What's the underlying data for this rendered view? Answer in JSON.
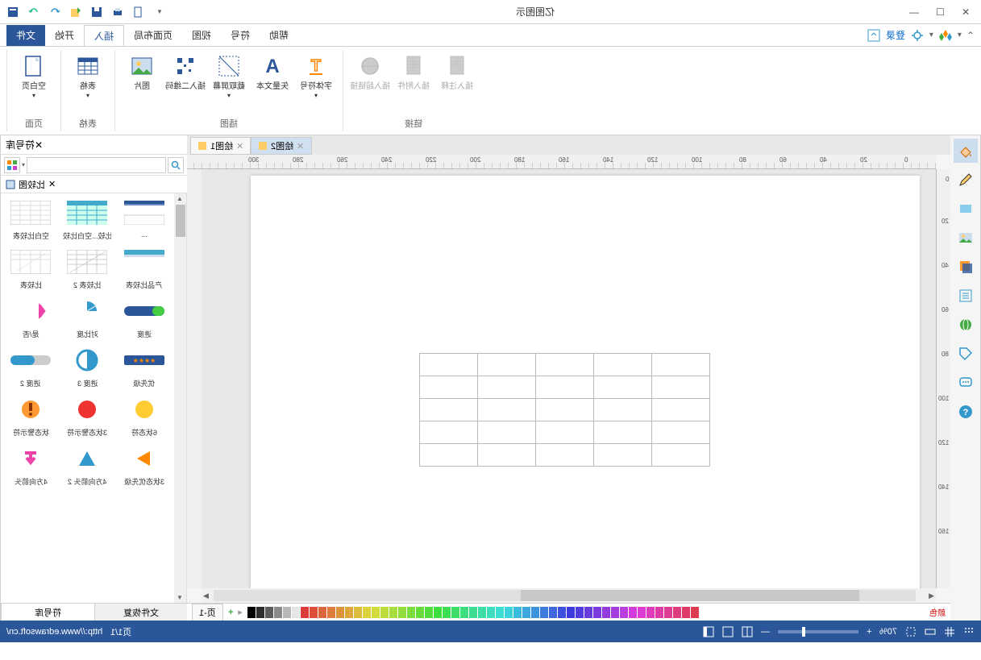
{
  "title": "亿图图示",
  "secondbar": {
    "login": "登录"
  },
  "tabs": [
    "文件",
    "开始",
    "插入",
    "页面布局",
    "视图",
    "符号",
    "帮助"
  ],
  "active_tab_index": 2,
  "file_tab_index": 0,
  "ribbon": {
    "groups": [
      {
        "label": "页面",
        "items": [
          {
            "label": "空白页"
          }
        ]
      },
      {
        "label": "表格",
        "items": [
          {
            "label": "表格"
          }
        ]
      },
      {
        "label": "插图",
        "items": [
          {
            "label": "图片"
          },
          {
            "label": "插入二维码"
          },
          {
            "label": "截取屏幕"
          },
          {
            "label": "矢量文本"
          },
          {
            "label": "字体符号"
          }
        ]
      },
      {
        "label": "链接",
        "items": [
          {
            "label": "插入超链接"
          },
          {
            "label": "插入附件"
          },
          {
            "label": "插入注释"
          }
        ]
      }
    ]
  },
  "doc_tabs": [
    {
      "label": "绘图1",
      "active": false
    },
    {
      "label": "绘图2",
      "active": true
    }
  ],
  "ruler_ticks_h": [
    "0",
    "20",
    "40",
    "60",
    "80",
    "100",
    "120",
    "140",
    "160",
    "180",
    "200",
    "220",
    "240",
    "260",
    "280",
    "300"
  ],
  "ruler_ticks_v": [
    "0",
    "20",
    "40",
    "60",
    "80",
    "100",
    "120",
    "140",
    "160"
  ],
  "sympanel": {
    "title": "符号库",
    "search_placeholder": "",
    "category": "比较图",
    "items": [
      {
        "label": "空白比较表"
      },
      {
        "label": "空白比较...空白比较"
      },
      {
        "label": "..."
      },
      {
        "label": "比较表"
      },
      {
        "label": "比较表 2"
      },
      {
        "label": "产品比较表"
      },
      {
        "label": "是/否"
      },
      {
        "label": "对比度"
      },
      {
        "label": "进度"
      },
      {
        "label": "进度 2"
      },
      {
        "label": "进度 3"
      },
      {
        "label": "优先级"
      },
      {
        "label": "状态警示符"
      },
      {
        "label": "3状态警示符"
      },
      {
        "label": "6状态符"
      },
      {
        "label": "4方向箭头"
      },
      {
        "label": "4方向箭头 2"
      },
      {
        "label": "3状态优先级"
      }
    ],
    "bottom_tabs": [
      "符号库",
      "文件恢复"
    ]
  },
  "page_tabs": {
    "current": "页-1"
  },
  "status": {
    "url": "http://www.edrawsoft.cn/",
    "page": "页1/1",
    "zoom": "70%"
  }
}
